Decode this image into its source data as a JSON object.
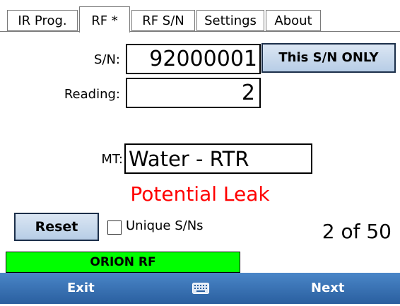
{
  "tabs": [
    {
      "label": "IR Prog.",
      "active": false
    },
    {
      "label": "RF *",
      "active": true
    },
    {
      "label": "RF S/N",
      "active": false
    },
    {
      "label": "Settings",
      "active": false
    },
    {
      "label": "About",
      "active": false
    }
  ],
  "form": {
    "sn_label": "S/N:",
    "sn_value": "92000001",
    "sn_only_button": "This S/N ONLY",
    "reading_label": "Reading:",
    "reading_value": "2",
    "mt_label": "MT:",
    "mt_value": "Water - RTR"
  },
  "warning_text": "Potential Leak",
  "warning_color": "#ff0000",
  "reset_button": "Reset",
  "unique_checkbox": {
    "label": "Unique S/Ns",
    "checked": false
  },
  "counter": "2 of 50",
  "status_bar": {
    "label": "ORION RF",
    "color": "#00ff00"
  },
  "bottom_bar": {
    "left": "Exit",
    "center_icon": "keyboard-icon",
    "right": "Next"
  }
}
